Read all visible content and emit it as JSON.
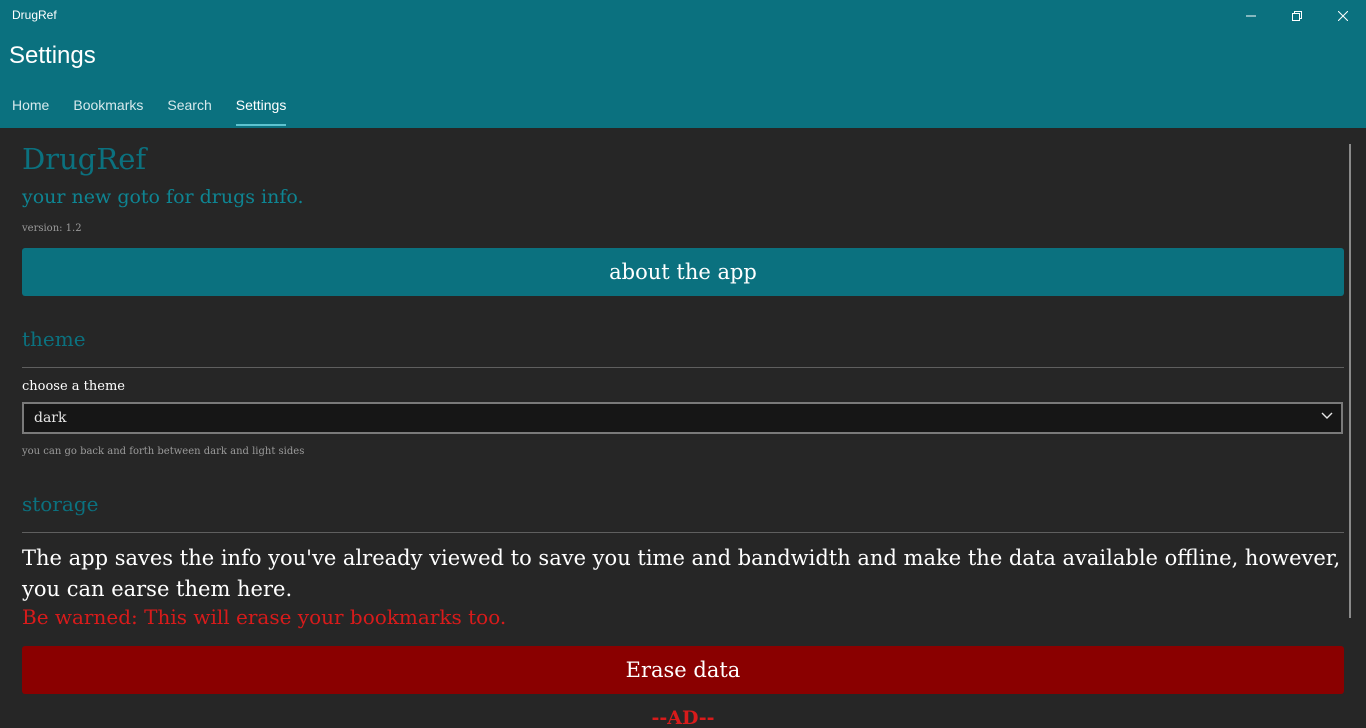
{
  "window": {
    "title": "DrugRef",
    "controls": {
      "minimize": "minimize-icon",
      "restore": "restore-icon",
      "close": "close-icon"
    }
  },
  "header": {
    "page_title": "Settings",
    "tabs": [
      {
        "label": "Home"
      },
      {
        "label": "Bookmarks"
      },
      {
        "label": "Search"
      },
      {
        "label": "Settings"
      }
    ],
    "active_tab": "Settings"
  },
  "about": {
    "app_name": "DrugRef",
    "tagline": "your new goto for drugs info.",
    "version": "version: 1.2",
    "button_label": "about the app"
  },
  "theme": {
    "section_title": "theme",
    "label": "choose a theme",
    "selected": "dark",
    "hint": "you can go back and forth between dark and light sides"
  },
  "storage": {
    "section_title": "storage",
    "description": "The app saves the info you've already viewed to save you time and bandwidth and make the data available offline, however, you can earse them here.",
    "warning": "Be warned: This will erase your bookmarks too.",
    "button_label": "Erase data"
  },
  "ad": {
    "label": "--AD--"
  },
  "colors": {
    "accent": "#0b717f",
    "background": "#262626",
    "danger": "#8a0000",
    "warning_text": "#d81b1b"
  }
}
